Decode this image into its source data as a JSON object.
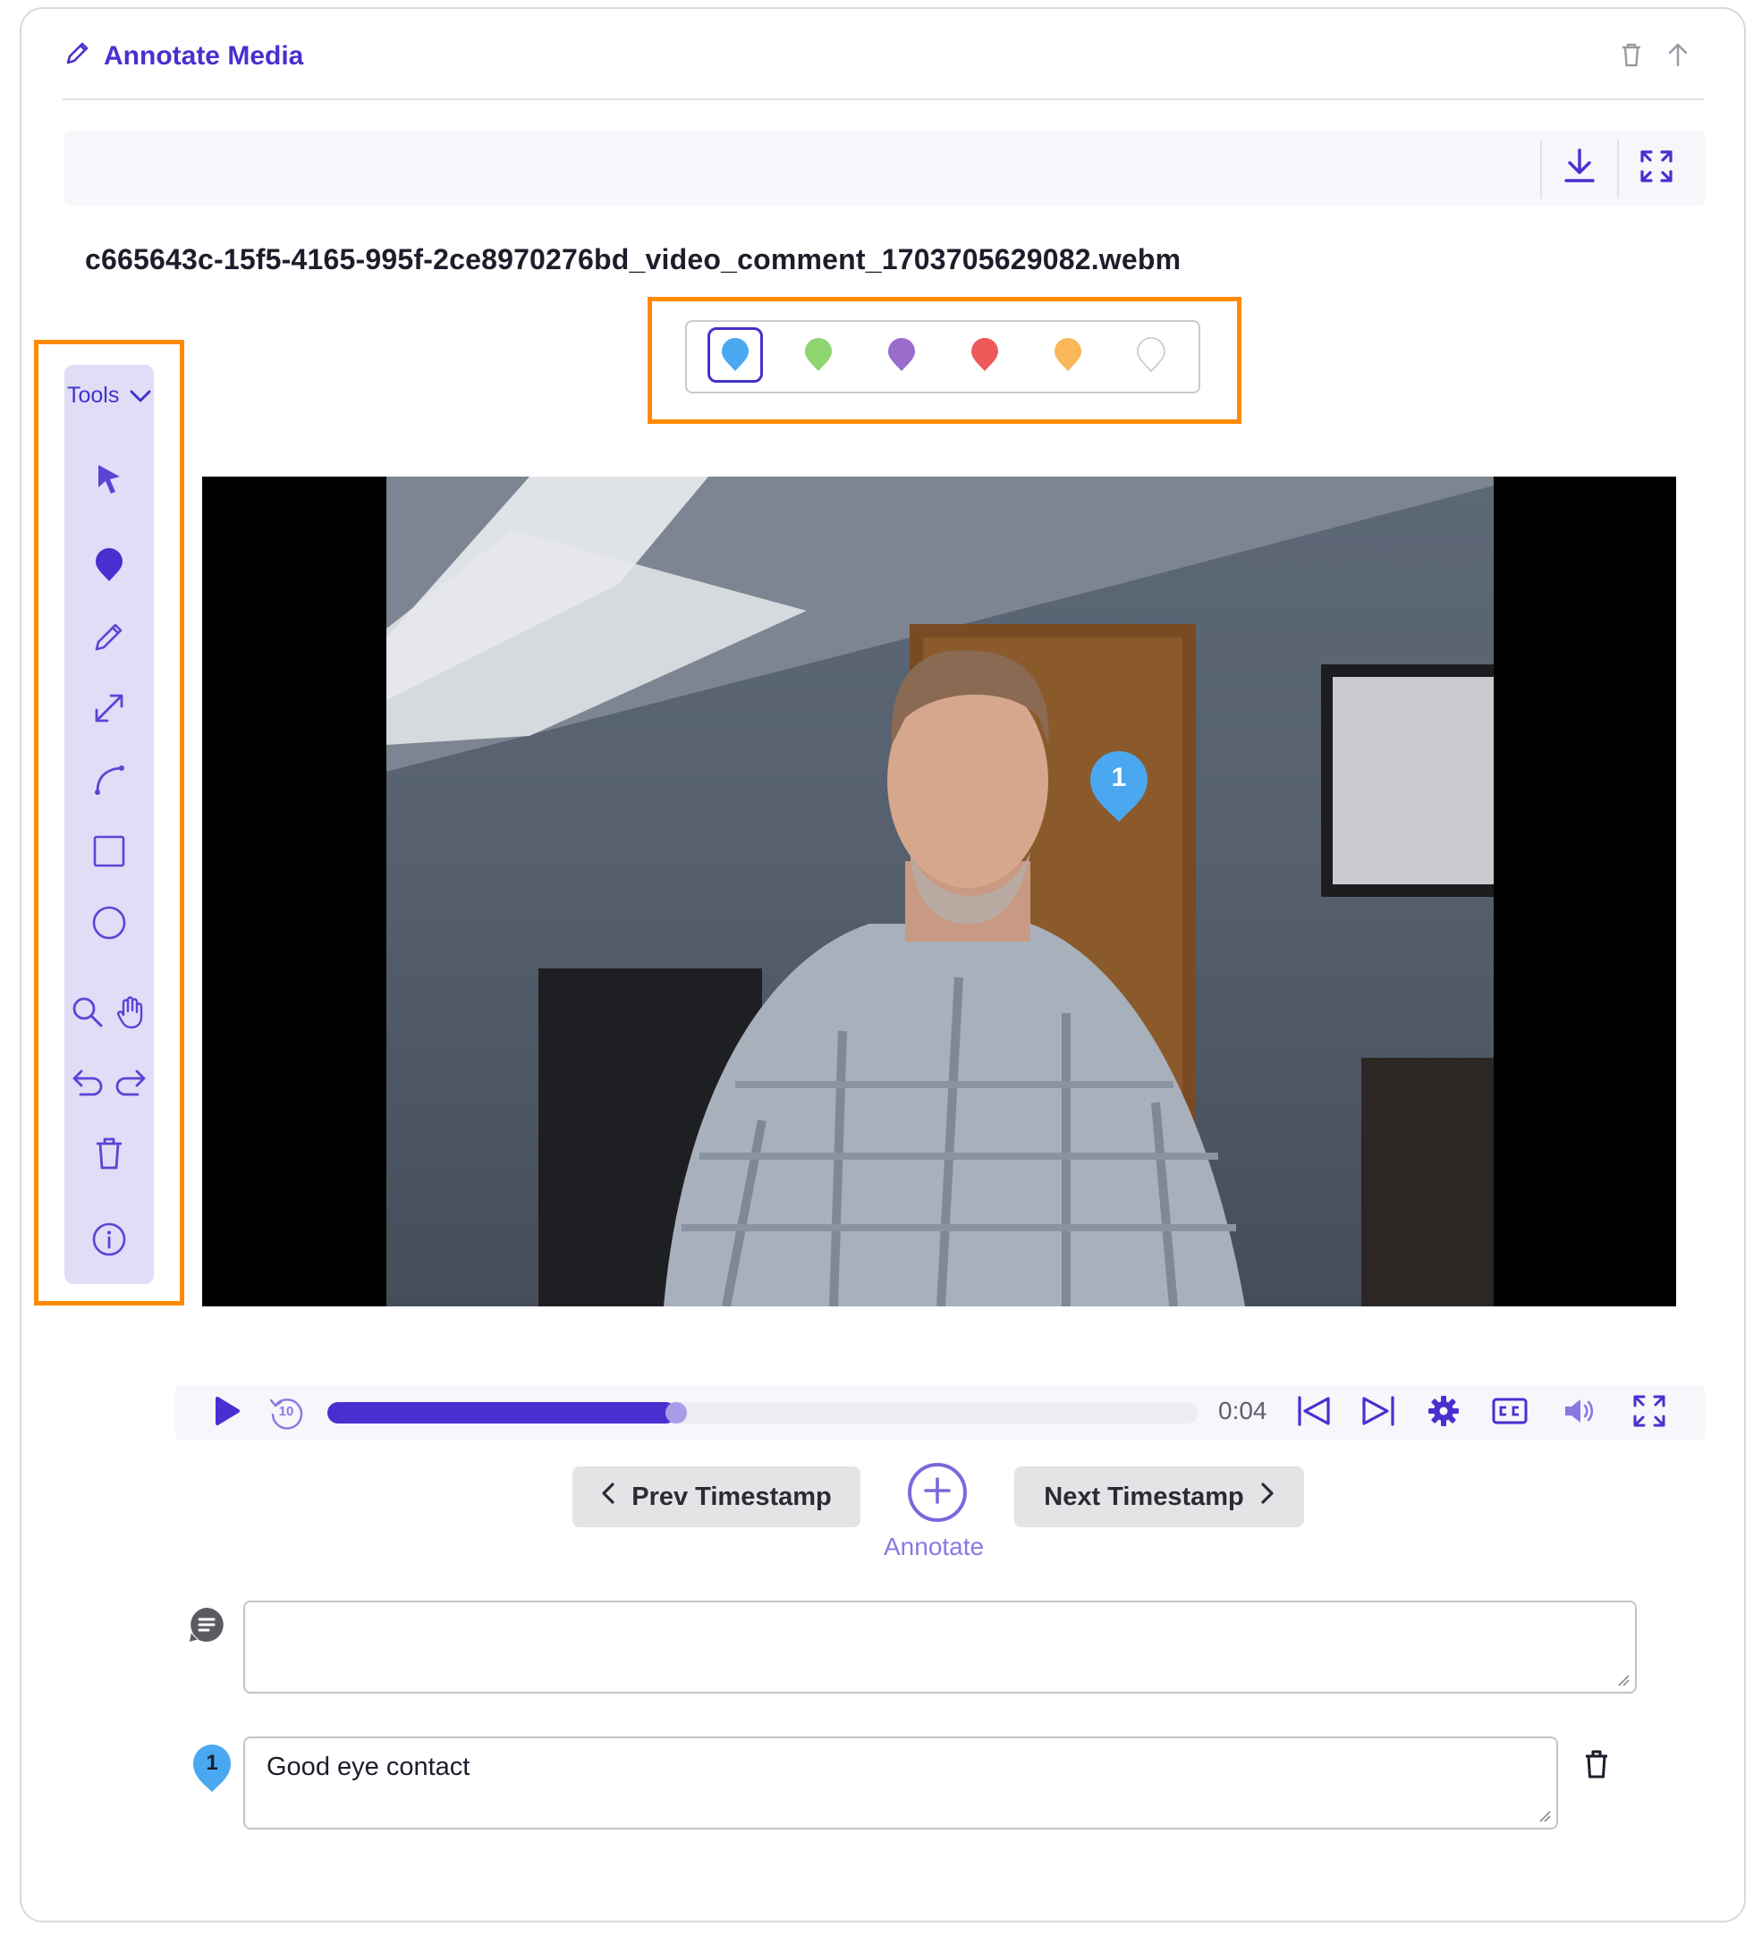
{
  "header": {
    "title": "Annotate Media",
    "icons": [
      "pencil-icon",
      "trash-icon",
      "arrow-up-icon"
    ]
  },
  "toolbar": {
    "icons": [
      "download-icon",
      "expand-icon"
    ]
  },
  "file": {
    "name": "c665643c-15f5-4165-995f-2ce8970276bd_video_comment_1703705629082.webm"
  },
  "palette": {
    "colors": [
      "#4aa8f0",
      "#8ed56f",
      "#9a6ccc",
      "#ee5a5a",
      "#f9b65a",
      "#ffffff"
    ],
    "selected_index": 0
  },
  "tools": {
    "label": "Tools",
    "items": [
      "pointer-icon",
      "pin-icon",
      "pencil-icon",
      "arrow-icon",
      "curve-icon",
      "rectangle-icon",
      "circle-icon",
      "zoom-icon",
      "pan-hand-icon",
      "undo-icon",
      "redo-icon",
      "trash-icon",
      "info-icon"
    ]
  },
  "video": {
    "marker_label": "1",
    "marker_color": "#4aa8f0"
  },
  "player": {
    "time": "0:04",
    "progress": 0.4,
    "skip_label": "10",
    "icons": [
      "play-icon",
      "replay-10-icon",
      "skip-back-icon",
      "skip-forward-icon",
      "settings-icon",
      "captions-icon",
      "volume-icon",
      "fullscreen-icon"
    ]
  },
  "nav": {
    "prev_label": "Prev Timestamp",
    "next_label": "Next Timestamp",
    "annotate_label": "Annotate"
  },
  "comments": {
    "new_comment_value": "",
    "items": [
      {
        "marker": "1",
        "text": "Good eye contact"
      }
    ]
  },
  "colors": {
    "accent": "#4a2fd0",
    "highlight": "#ff8a00",
    "tools_bg": "#e0ddf7"
  }
}
